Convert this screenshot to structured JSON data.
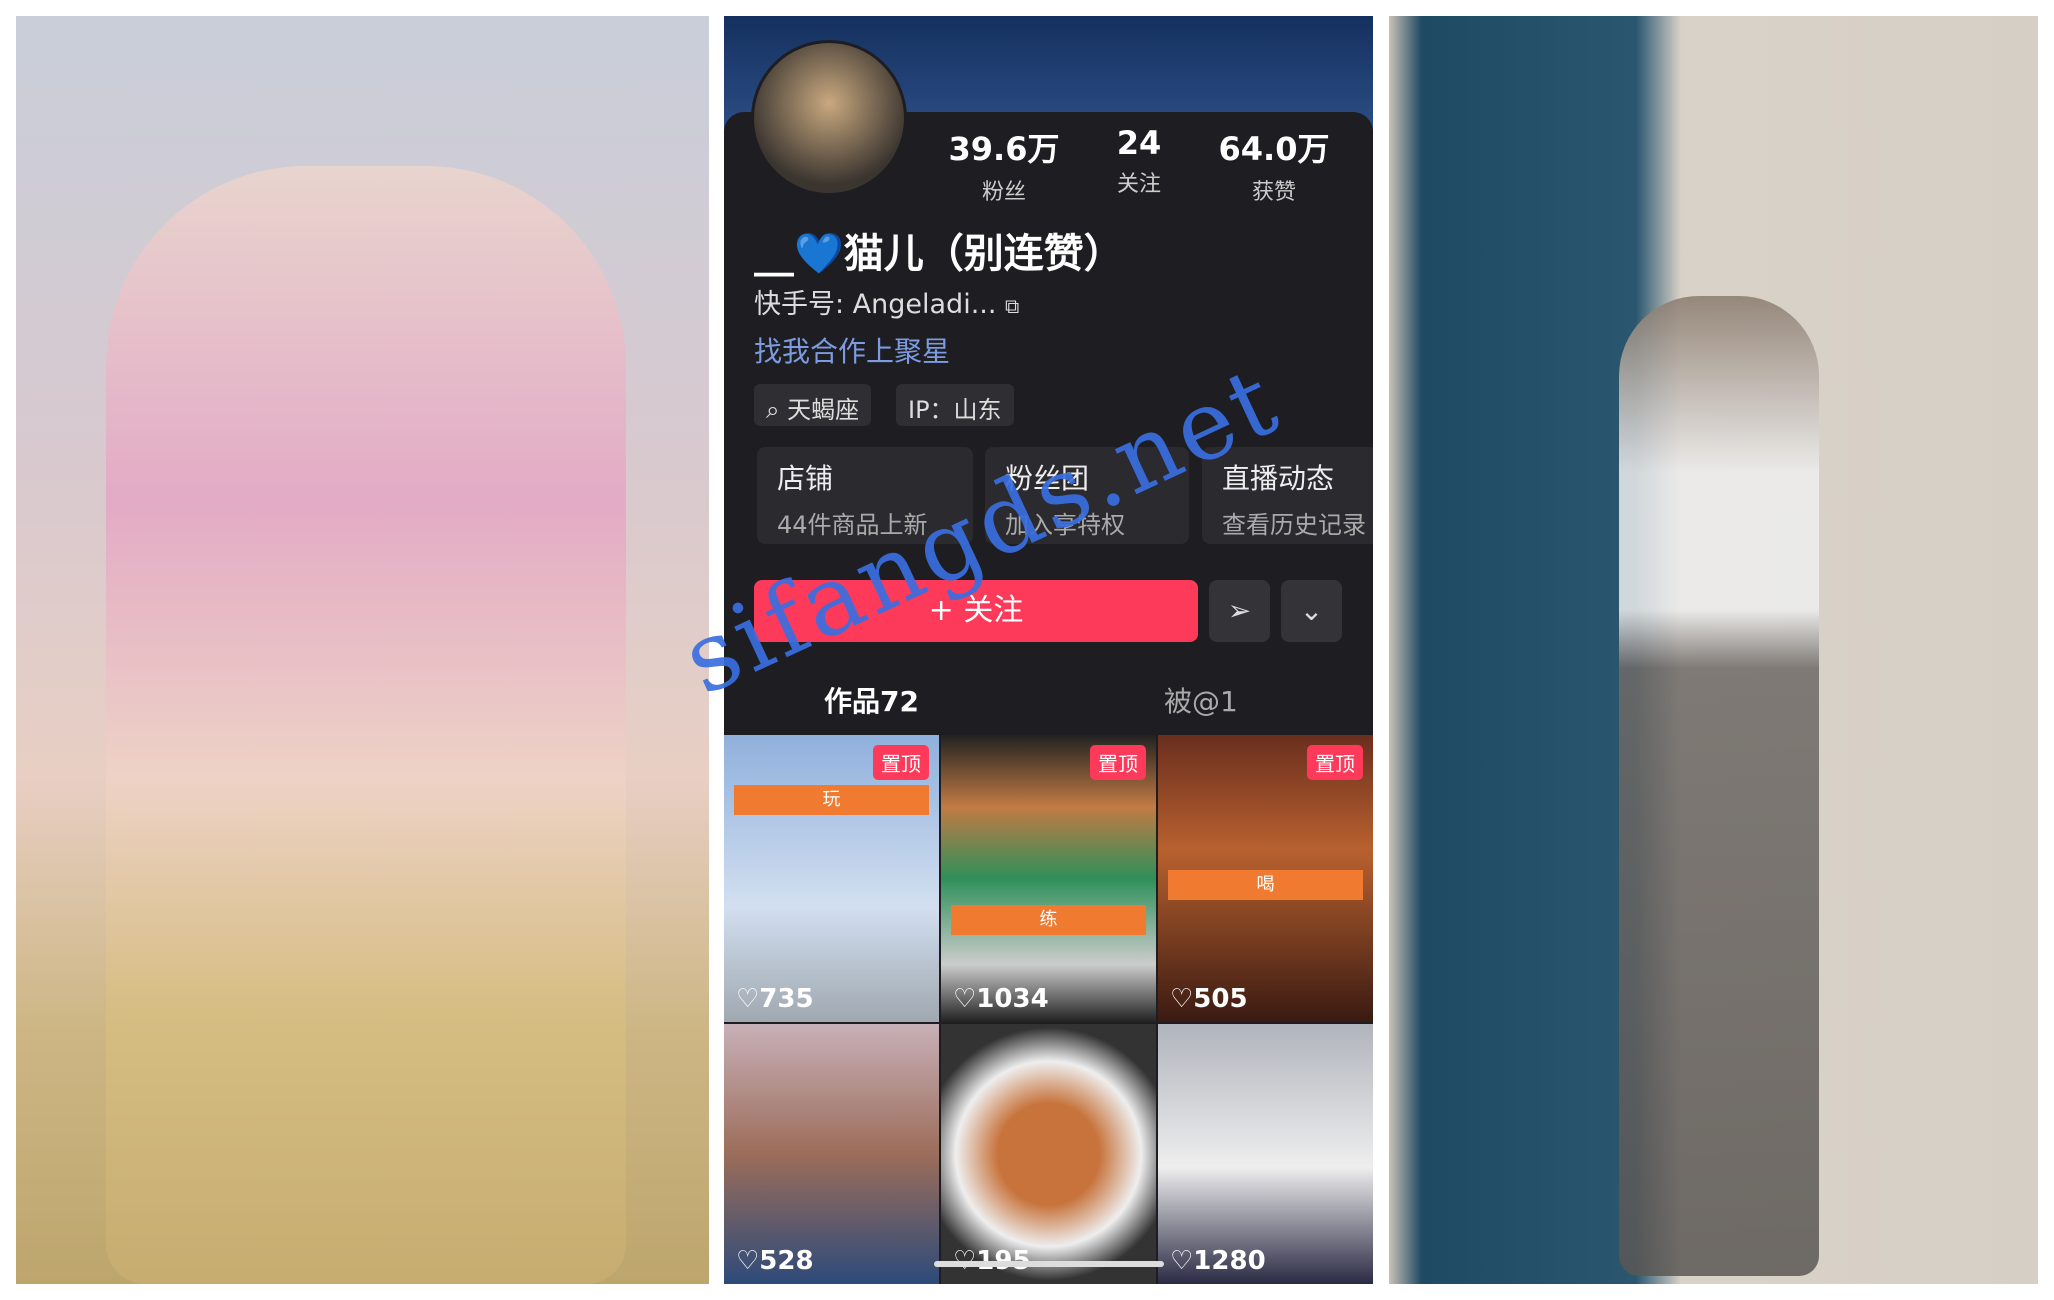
{
  "profile": {
    "stats": [
      {
        "value": "39.6万",
        "label": "粉丝"
      },
      {
        "value": "24",
        "label": "关注"
      },
      {
        "value": "64.0万",
        "label": "获赞"
      }
    ],
    "name": "__💙猫儿（别连赞）",
    "account_id": "快手号: Angeladi...",
    "promo_link": "找我合作上聚星",
    "tags": [
      "⌕ 天蝎座",
      "IP：山东"
    ],
    "cards": [
      {
        "title": "店铺",
        "sub": "44件商品上新"
      },
      {
        "title": "粉丝团",
        "sub": "加入享特权"
      },
      {
        "title": "直播动态",
        "sub": "查看历史记录"
      }
    ],
    "follow_label": "+ 关注",
    "tabs": [
      "作品72",
      "被@1"
    ],
    "grid": [
      {
        "pinned": "置顶",
        "band": "玩",
        "likes": "♡735",
        "bg": "linear-gradient(180deg,#8fb0dc,#d2dff0 60%,#a0a8b0)"
      },
      {
        "pinned": "置顶",
        "band": "练",
        "likes": "♡1034",
        "bg": "linear-gradient(180deg,#222 0%,#c27a43 25%,#2f8f5a 50%,#ccc 80%,#222)"
      },
      {
        "pinned": "置顶",
        "band": "喝",
        "likes": "♡505",
        "bg": "linear-gradient(180deg,#6a2e1e,#b8612f 40%,#3a1a12)"
      },
      {
        "likes": "♡528",
        "bg": "linear-gradient(180deg,#c8b0b8,#9c6d5a 50%,#2d4a7a)"
      },
      {
        "likes": "♡195",
        "bg": "radial-gradient(circle,#c7733b 30%,#eee 55%,#333 75%)"
      },
      {
        "likes": "♡1280",
        "bg": "linear-gradient(180deg,#b0b4bc,#eee 55%,#2a2a44)"
      }
    ]
  },
  "watermark": "sifangds.net"
}
